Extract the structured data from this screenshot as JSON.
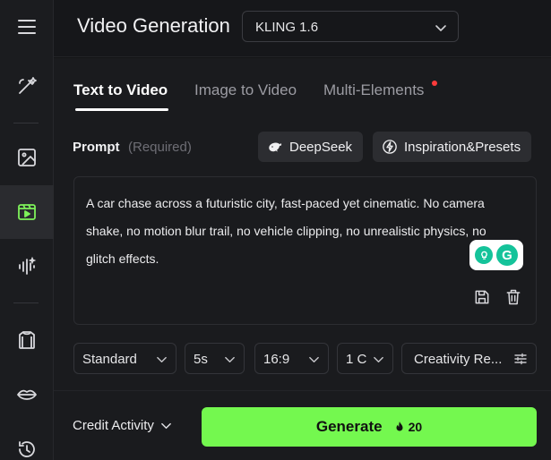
{
  "header": {
    "title": "Video Generation",
    "model": "KLING 1.6"
  },
  "tabs": [
    {
      "label": "Text to Video",
      "active": true
    },
    {
      "label": "Image to Video",
      "active": false
    },
    {
      "label": "Multi-Elements",
      "active": false,
      "has_new_dot": true
    }
  ],
  "prompt": {
    "label": "Prompt",
    "required": "(Required)",
    "text": " A car chase across a futuristic city, fast-paced yet cinematic. No camera shake, no motion blur trail, no vehicle clipping, no unrealistic physics, no glitch effects."
  },
  "actions": {
    "deepseek": "DeepSeek",
    "inspiration": "Inspiration&Presets"
  },
  "options": {
    "mode": "Standard",
    "duration": "5s",
    "aspect": "16:9",
    "count": "1 C",
    "creativity": "Creativity Re..."
  },
  "footer": {
    "credit": "Credit Activity",
    "generate": "Generate",
    "cost": "20"
  },
  "rail": [
    "menu-icon",
    "magic-wand-icon",
    "image-icon",
    "video-icon",
    "audio-wave-icon",
    "shirt-icon",
    "lips-icon",
    "history-icon"
  ],
  "colors": {
    "accent": "#74f84f",
    "active_icon": "#7ef25a",
    "dot": "#ff3b3b"
  }
}
